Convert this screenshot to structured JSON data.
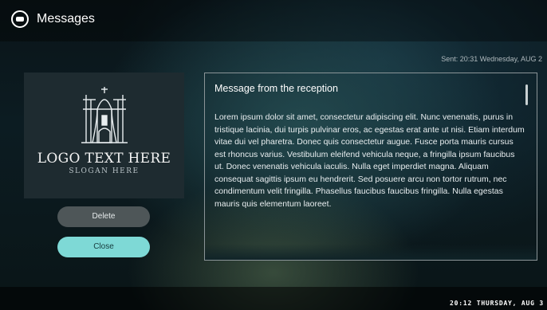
{
  "header": {
    "icon": "message-bubble-icon",
    "title": "Messages"
  },
  "message": {
    "sent": "Sent: 20:31 Wednesday, AUG 2",
    "title": "Message from the reception",
    "body": "Lorem ipsum dolor sit amet, consectetur adipiscing elit. Nunc venenatis, purus in tristique lacinia, dui turpis pulvinar eros, ac egestas erat ante ut nisi. Etiam interdum vitae dui vel pharetra. Donec quis consectetur augue. Fusce porta mauris cursus est rhoncus varius. Vestibulum eleifend vehicula neque, a fringilla ipsum faucibus ut. Donec venenatis vehicula iaculis. Nulla eget imperdiet magna. Aliquam consequat sagittis ipsum eu hendrerit. Sed posuere arcu non tortor rutrum, nec condimentum velit fringilla. Phasellus faucibus faucibus fringilla. Nulla egestas mauris quis elementum laoreet."
  },
  "logo": {
    "text": "LOGO TEXT HERE",
    "slogan": "SLOGAN HERE",
    "icon": "cathedral-logo-icon"
  },
  "actions": {
    "delete_label": "Delete",
    "close_label": "Close"
  },
  "footer": {
    "clock": "20:12 THURSDAY, AUG 3"
  },
  "colors": {
    "accent": "#7ed9d6",
    "delete_button": "#4e5658"
  }
}
